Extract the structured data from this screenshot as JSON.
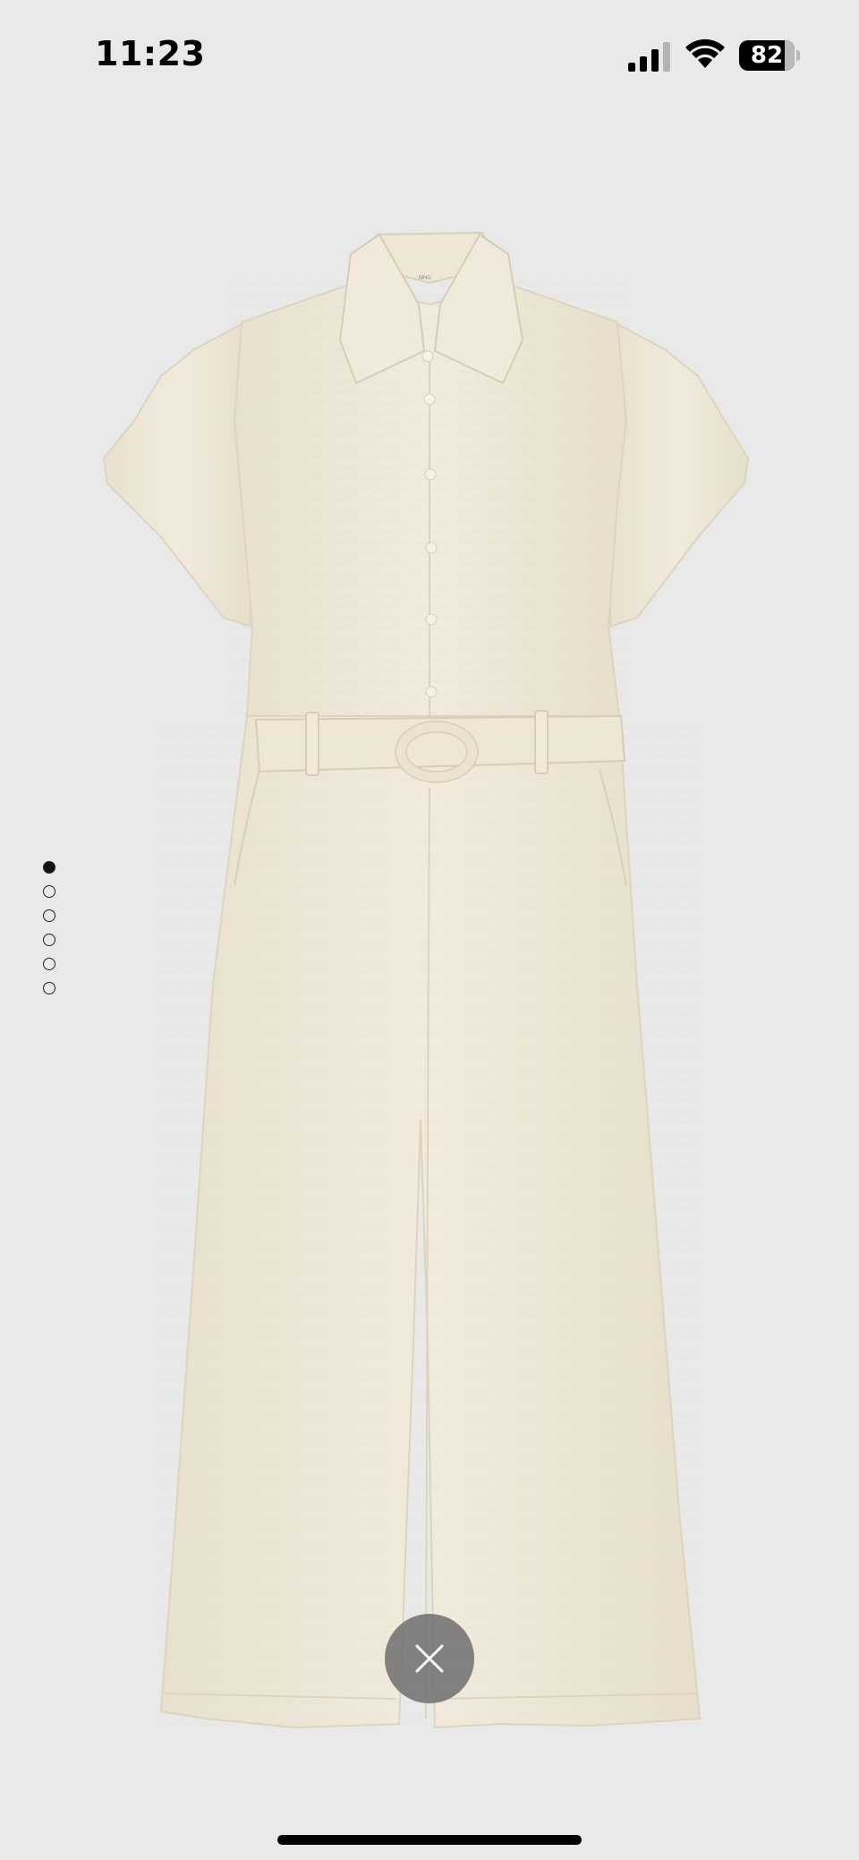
{
  "status_bar": {
    "time": "11:23",
    "battery_level": 82,
    "battery_text": "82",
    "signal_bars_active": 3,
    "signal_bars_total": 4,
    "signal-icon": "signal-icon",
    "wifi-icon": "wifi-icon"
  },
  "product_image": {
    "garment_color": "#efe8d8",
    "background_color": "#e8e9e8",
    "label_text": "MNG"
  },
  "pager": {
    "count": 6,
    "active_index": 0
  },
  "close_button": {
    "icon": "close-icon"
  },
  "colors": {
    "close_button_bg": "#6e6e6e",
    "pager_active": "#111111"
  }
}
